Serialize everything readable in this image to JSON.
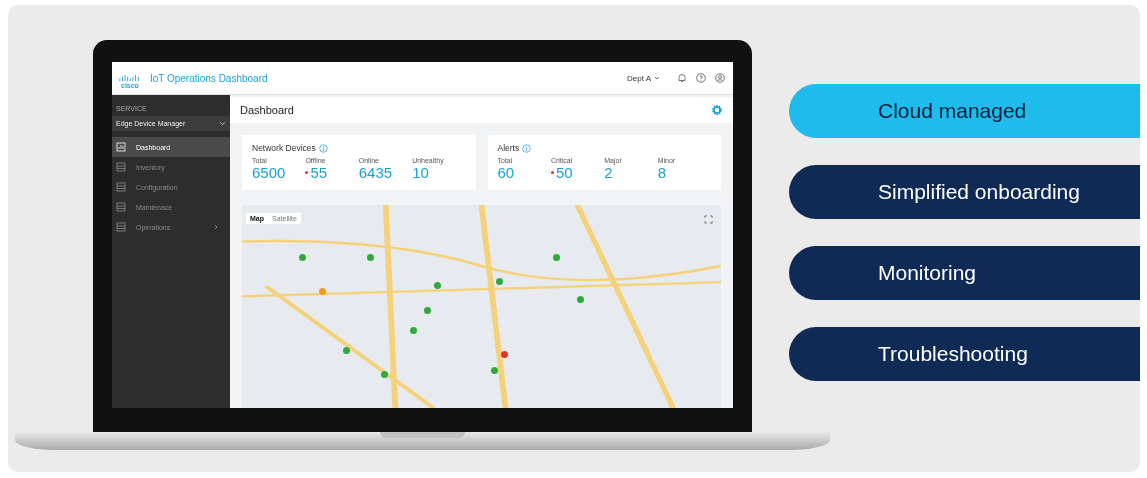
{
  "header": {
    "logo_text": "cisco",
    "brand": "IoT Operations Dashboard",
    "dept": "Dept A"
  },
  "sidebar": {
    "section": "SERVICE",
    "service": "Edge Device Manager",
    "items": [
      {
        "label": "Dashboard",
        "selected": true,
        "has_children": false
      },
      {
        "label": "Inventory",
        "selected": false,
        "has_children": false
      },
      {
        "label": "Configuration",
        "selected": false,
        "has_children": false
      },
      {
        "label": "Maintenace",
        "selected": false,
        "has_children": false
      },
      {
        "label": "Operations",
        "selected": false,
        "has_children": true
      }
    ]
  },
  "page_title": "Dashboard",
  "cards": [
    {
      "title": "Network Devices",
      "stats": [
        {
          "label": "Total",
          "value": "6500",
          "alert": false
        },
        {
          "label": "Offline",
          "value": "55",
          "alert": true
        },
        {
          "label": "Online",
          "value": "6435",
          "alert": false
        },
        {
          "label": "Unhealthy",
          "value": "10",
          "alert": false
        }
      ]
    },
    {
      "title": "Alerts",
      "stats": [
        {
          "label": "Total",
          "value": "60",
          "alert": false
        },
        {
          "label": "Critical",
          "value": "50",
          "alert": true
        },
        {
          "label": "Major",
          "value": "2",
          "alert": false
        },
        {
          "label": "Minor",
          "value": "8",
          "alert": false
        }
      ]
    }
  ],
  "map": {
    "view_toggle": [
      {
        "label": "Map",
        "selected": true
      },
      {
        "label": "Satellite",
        "selected": false
      }
    ]
  },
  "features": [
    {
      "label": "Cloud managed",
      "highlighted": true
    },
    {
      "label": "Simplified onboarding",
      "highlighted": false
    },
    {
      "label": "Monitoring",
      "highlighted": false
    },
    {
      "label": "Troubleshooting",
      "highlighted": false
    }
  ]
}
